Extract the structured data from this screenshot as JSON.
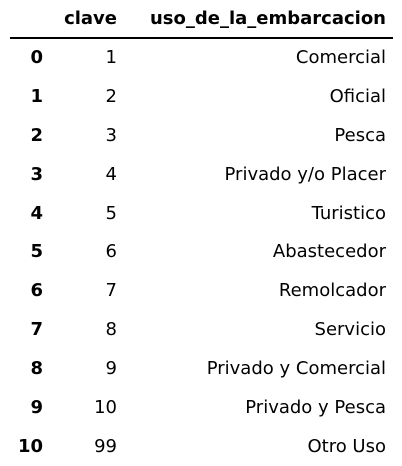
{
  "table": {
    "columns": [
      "",
      "clave",
      "uso_de_la_embarcacion"
    ],
    "rows": [
      {
        "index": "0",
        "clave": "1",
        "uso": "Comercial"
      },
      {
        "index": "1",
        "clave": "2",
        "uso": "Oficial"
      },
      {
        "index": "2",
        "clave": "3",
        "uso": "Pesca"
      },
      {
        "index": "3",
        "clave": "4",
        "uso": "Privado y/o Placer"
      },
      {
        "index": "4",
        "clave": "5",
        "uso": "Turistico"
      },
      {
        "index": "5",
        "clave": "6",
        "uso": "Abastecedor"
      },
      {
        "index": "6",
        "clave": "7",
        "uso": "Remolcador"
      },
      {
        "index": "7",
        "clave": "8",
        "uso": "Servicio"
      },
      {
        "index": "8",
        "clave": "9",
        "uso": "Privado y Comercial"
      },
      {
        "index": "9",
        "clave": "10",
        "uso": "Privado y Pesca"
      },
      {
        "index": "10",
        "clave": "99",
        "uso": "Otro Uso"
      }
    ]
  }
}
